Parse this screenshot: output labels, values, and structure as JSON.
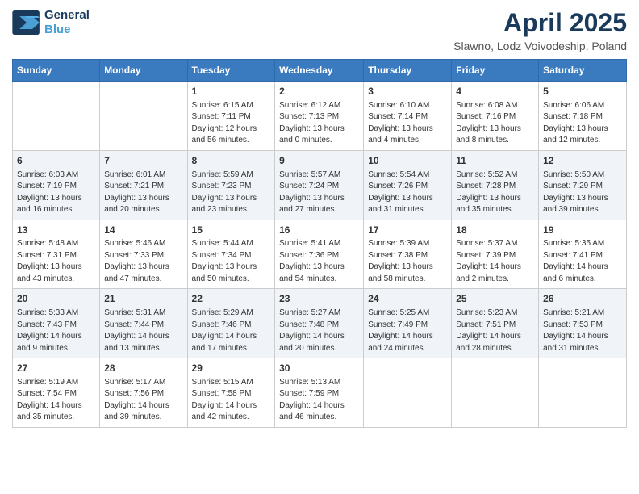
{
  "logo": {
    "line1": "General",
    "line2": "Blue"
  },
  "title": "April 2025",
  "subtitle": "Slawno, Lodz Voivodeship, Poland",
  "days_of_week": [
    "Sunday",
    "Monday",
    "Tuesday",
    "Wednesday",
    "Thursday",
    "Friday",
    "Saturday"
  ],
  "weeks": [
    [
      {
        "day": "",
        "info": ""
      },
      {
        "day": "",
        "info": ""
      },
      {
        "day": "1",
        "info": "Sunrise: 6:15 AM\nSunset: 7:11 PM\nDaylight: 12 hours\nand 56 minutes."
      },
      {
        "day": "2",
        "info": "Sunrise: 6:12 AM\nSunset: 7:13 PM\nDaylight: 13 hours\nand 0 minutes."
      },
      {
        "day": "3",
        "info": "Sunrise: 6:10 AM\nSunset: 7:14 PM\nDaylight: 13 hours\nand 4 minutes."
      },
      {
        "day": "4",
        "info": "Sunrise: 6:08 AM\nSunset: 7:16 PM\nDaylight: 13 hours\nand 8 minutes."
      },
      {
        "day": "5",
        "info": "Sunrise: 6:06 AM\nSunset: 7:18 PM\nDaylight: 13 hours\nand 12 minutes."
      }
    ],
    [
      {
        "day": "6",
        "info": "Sunrise: 6:03 AM\nSunset: 7:19 PM\nDaylight: 13 hours\nand 16 minutes."
      },
      {
        "day": "7",
        "info": "Sunrise: 6:01 AM\nSunset: 7:21 PM\nDaylight: 13 hours\nand 20 minutes."
      },
      {
        "day": "8",
        "info": "Sunrise: 5:59 AM\nSunset: 7:23 PM\nDaylight: 13 hours\nand 23 minutes."
      },
      {
        "day": "9",
        "info": "Sunrise: 5:57 AM\nSunset: 7:24 PM\nDaylight: 13 hours\nand 27 minutes."
      },
      {
        "day": "10",
        "info": "Sunrise: 5:54 AM\nSunset: 7:26 PM\nDaylight: 13 hours\nand 31 minutes."
      },
      {
        "day": "11",
        "info": "Sunrise: 5:52 AM\nSunset: 7:28 PM\nDaylight: 13 hours\nand 35 minutes."
      },
      {
        "day": "12",
        "info": "Sunrise: 5:50 AM\nSunset: 7:29 PM\nDaylight: 13 hours\nand 39 minutes."
      }
    ],
    [
      {
        "day": "13",
        "info": "Sunrise: 5:48 AM\nSunset: 7:31 PM\nDaylight: 13 hours\nand 43 minutes."
      },
      {
        "day": "14",
        "info": "Sunrise: 5:46 AM\nSunset: 7:33 PM\nDaylight: 13 hours\nand 47 minutes."
      },
      {
        "day": "15",
        "info": "Sunrise: 5:44 AM\nSunset: 7:34 PM\nDaylight: 13 hours\nand 50 minutes."
      },
      {
        "day": "16",
        "info": "Sunrise: 5:41 AM\nSunset: 7:36 PM\nDaylight: 13 hours\nand 54 minutes."
      },
      {
        "day": "17",
        "info": "Sunrise: 5:39 AM\nSunset: 7:38 PM\nDaylight: 13 hours\nand 58 minutes."
      },
      {
        "day": "18",
        "info": "Sunrise: 5:37 AM\nSunset: 7:39 PM\nDaylight: 14 hours\nand 2 minutes."
      },
      {
        "day": "19",
        "info": "Sunrise: 5:35 AM\nSunset: 7:41 PM\nDaylight: 14 hours\nand 6 minutes."
      }
    ],
    [
      {
        "day": "20",
        "info": "Sunrise: 5:33 AM\nSunset: 7:43 PM\nDaylight: 14 hours\nand 9 minutes."
      },
      {
        "day": "21",
        "info": "Sunrise: 5:31 AM\nSunset: 7:44 PM\nDaylight: 14 hours\nand 13 minutes."
      },
      {
        "day": "22",
        "info": "Sunrise: 5:29 AM\nSunset: 7:46 PM\nDaylight: 14 hours\nand 17 minutes."
      },
      {
        "day": "23",
        "info": "Sunrise: 5:27 AM\nSunset: 7:48 PM\nDaylight: 14 hours\nand 20 minutes."
      },
      {
        "day": "24",
        "info": "Sunrise: 5:25 AM\nSunset: 7:49 PM\nDaylight: 14 hours\nand 24 minutes."
      },
      {
        "day": "25",
        "info": "Sunrise: 5:23 AM\nSunset: 7:51 PM\nDaylight: 14 hours\nand 28 minutes."
      },
      {
        "day": "26",
        "info": "Sunrise: 5:21 AM\nSunset: 7:53 PM\nDaylight: 14 hours\nand 31 minutes."
      }
    ],
    [
      {
        "day": "27",
        "info": "Sunrise: 5:19 AM\nSunset: 7:54 PM\nDaylight: 14 hours\nand 35 minutes."
      },
      {
        "day": "28",
        "info": "Sunrise: 5:17 AM\nSunset: 7:56 PM\nDaylight: 14 hours\nand 39 minutes."
      },
      {
        "day": "29",
        "info": "Sunrise: 5:15 AM\nSunset: 7:58 PM\nDaylight: 14 hours\nand 42 minutes."
      },
      {
        "day": "30",
        "info": "Sunrise: 5:13 AM\nSunset: 7:59 PM\nDaylight: 14 hours\nand 46 minutes."
      },
      {
        "day": "",
        "info": ""
      },
      {
        "day": "",
        "info": ""
      },
      {
        "day": "",
        "info": ""
      }
    ]
  ]
}
